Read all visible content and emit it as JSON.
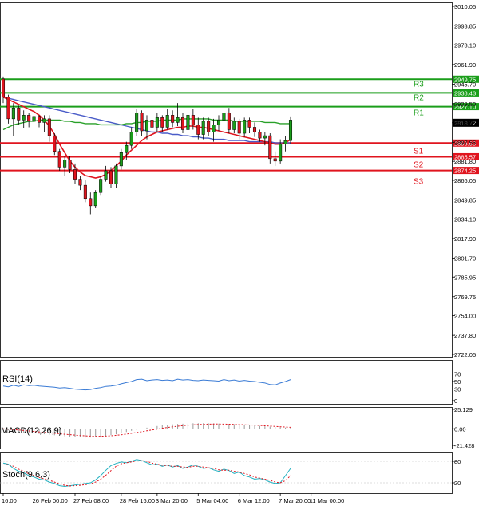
{
  "chart_data": {
    "type": "candlestick",
    "panes": {
      "price": {
        "y_ticks": [
          "3010.05",
          "2993.85",
          "2978.10",
          "2961.90",
          "2945.70",
          "2929.50",
          "2913.75",
          "2897.55",
          "2881.80",
          "2866.05",
          "2849.85",
          "2834.10",
          "2817.90",
          "2801.70",
          "2785.95",
          "2769.75",
          "2754.00",
          "2737.80",
          "2722.05"
        ],
        "ylim": [
          2722.05,
          3010.05
        ],
        "current_price": {
          "label": "2913.72",
          "value": 2913.72
        },
        "levels": [
          {
            "name": "R3",
            "value": 2949.75,
            "label": "2949.75",
            "color": "#1a9e1a"
          },
          {
            "name": "R2",
            "value": 2938.43,
            "label": "2938.43",
            "color": "#1a9e1a"
          },
          {
            "name": "R1",
            "value": 2927.1,
            "label": "2927.10",
            "color": "#1a9e1a"
          },
          {
            "name": "",
            "value": 2896.9,
            "label": "2896.90",
            "color": "#e0141e"
          },
          {
            "name": "S1",
            "value": 2885.57,
            "label": "2885.57",
            "color": "#e0141e"
          },
          {
            "name": "S2",
            "value": 2874.25,
            "label": "2874.25",
            "color": "#e0141e"
          },
          {
            "name": "S3",
            "value": 2874.25,
            "label": "",
            "color": "#e0141e"
          }
        ],
        "candles": [
          [
            2950,
            2952,
            2930,
            2935
          ],
          [
            2935,
            2937,
            2913,
            2917
          ],
          [
            2917,
            2930,
            2903,
            2926
          ],
          [
            2926,
            2928,
            2912,
            2916
          ],
          [
            2916,
            2924,
            2909,
            2920
          ],
          [
            2920,
            2922,
            2910,
            2915
          ],
          [
            2915,
            2922,
            2908,
            2919
          ],
          [
            2919,
            2920,
            2910,
            2914
          ],
          [
            2914,
            2920,
            2906,
            2917
          ],
          [
            2917,
            2920,
            2898,
            2903
          ],
          [
            2903,
            2905,
            2887,
            2890
          ],
          [
            2890,
            2892,
            2874,
            2877
          ],
          [
            2877,
            2886,
            2870,
            2883
          ],
          [
            2883,
            2886,
            2872,
            2875
          ],
          [
            2875,
            2880,
            2863,
            2867
          ],
          [
            2867,
            2870,
            2858,
            2862
          ],
          [
            2862,
            2866,
            2848,
            2851
          ],
          [
            2851,
            2856,
            2838,
            2845
          ],
          [
            2845,
            2858,
            2843,
            2856
          ],
          [
            2856,
            2870,
            2854,
            2867
          ],
          [
            2867,
            2878,
            2865,
            2874
          ],
          [
            2874,
            2877,
            2860,
            2863
          ],
          [
            2863,
            2880,
            2860,
            2878
          ],
          [
            2878,
            2892,
            2875,
            2889
          ],
          [
            2889,
            2898,
            2883,
            2895
          ],
          [
            2895,
            2910,
            2892,
            2906
          ],
          [
            2906,
            2925,
            2903,
            2922
          ],
          [
            2922,
            2924,
            2903,
            2907
          ],
          [
            2907,
            2920,
            2900,
            2916
          ],
          [
            2916,
            2918,
            2905,
            2910
          ],
          [
            2910,
            2922,
            2906,
            2918
          ],
          [
            2918,
            2920,
            2906,
            2910
          ],
          [
            2910,
            2925,
            2908,
            2920
          ],
          [
            2920,
            2924,
            2910,
            2914
          ],
          [
            2914,
            2930,
            2911,
            2918
          ],
          [
            2918,
            2922,
            2905,
            2908
          ],
          [
            2908,
            2924,
            2905,
            2920
          ],
          [
            2920,
            2925,
            2908,
            2912
          ],
          [
            2912,
            2918,
            2900,
            2904
          ],
          [
            2904,
            2918,
            2900,
            2915
          ],
          [
            2915,
            2918,
            2903,
            2906
          ],
          [
            2906,
            2917,
            2898,
            2912
          ],
          [
            2912,
            2920,
            2907,
            2916
          ],
          [
            2916,
            2930,
            2912,
            2922
          ],
          [
            2922,
            2926,
            2905,
            2908
          ],
          [
            2908,
            2918,
            2905,
            2915
          ],
          [
            2915,
            2917,
            2900,
            2905
          ],
          [
            2905,
            2918,
            2902,
            2916
          ],
          [
            2916,
            2918,
            2905,
            2910
          ],
          [
            2910,
            2914,
            2902,
            2906
          ],
          [
            2906,
            2908,
            2898,
            2901
          ],
          [
            2901,
            2906,
            2895,
            2903
          ],
          [
            2903,
            2905,
            2880,
            2884
          ],
          [
            2884,
            2890,
            2878,
            2882
          ],
          [
            2882,
            2900,
            2880,
            2896
          ],
          [
            2896,
            2903,
            2890,
            2899
          ],
          [
            2899,
            2919,
            2896,
            2916
          ]
        ],
        "ma_red": [
          2935,
          2933,
          2931,
          2929,
          2927,
          2925,
          2923,
          2920,
          2916,
          2911,
          2904,
          2896,
          2889,
          2882,
          2877,
          2873,
          2870,
          2869,
          2868,
          2869,
          2871,
          2874,
          2878,
          2882,
          2887,
          2891,
          2895,
          2899,
          2902,
          2904,
          2906,
          2907,
          2908,
          2909,
          2910,
          2910,
          2911,
          2911,
          2910,
          2910,
          2909,
          2908,
          2907,
          2906,
          2905,
          2904,
          2903,
          2902,
          2901,
          2900,
          2899,
          2898,
          2897,
          2896,
          2896,
          2897,
          2900
        ],
        "ma_green": [
          2908,
          2910,
          2912,
          2913,
          2914,
          2915,
          2915,
          2916,
          2916,
          2916,
          2916,
          2916,
          2915,
          2915,
          2914,
          2914,
          2913,
          2913,
          2913,
          2912,
          2912,
          2912,
          2912,
          2912,
          2913,
          2913,
          2914,
          2914,
          2915,
          2915,
          2915,
          2916,
          2916,
          2916,
          2916,
          2917,
          2917,
          2917,
          2917,
          2917,
          2917,
          2916,
          2916,
          2916,
          2916,
          2915,
          2915,
          2915,
          2915,
          2915,
          2915,
          2914,
          2914,
          2914,
          2913,
          2913,
          2913
        ],
        "ma_blue": [
          2935,
          2934,
          2933,
          2932,
          2931,
          2930,
          2929,
          2928,
          2927,
          2926,
          2925,
          2924,
          2923,
          2922,
          2921,
          2920,
          2919,
          2918,
          2917,
          2916,
          2915,
          2914,
          2913,
          2912,
          2911,
          2910,
          2909,
          2908,
          2907,
          2906,
          2906,
          2905,
          2905,
          2904,
          2904,
          2903,
          2903,
          2902,
          2902,
          2901,
          2901,
          2900,
          2900,
          2900,
          2899,
          2899,
          2899,
          2899,
          2898,
          2898,
          2898,
          2898,
          2898,
          2897,
          2897,
          2897,
          2897
        ]
      },
      "rsi": {
        "title": "RSI(14)",
        "y_ticks": [
          "70",
          "50",
          "30",
          "0"
        ],
        "ylim": [
          0,
          100
        ],
        "values": [
          38,
          36,
          40,
          37,
          41,
          39,
          40,
          38,
          37,
          36,
          35,
          33,
          34,
          32,
          30,
          29,
          28,
          29,
          32,
          34,
          37,
          38,
          40,
          44,
          47,
          50,
          55,
          56,
          52,
          54,
          55,
          53,
          54,
          52,
          56,
          54,
          55,
          53,
          52,
          54,
          53,
          52,
          51,
          55,
          52,
          54,
          51,
          53,
          51,
          50,
          48,
          46,
          42,
          41,
          46,
          50,
          55
        ]
      },
      "macd": {
        "title": "MACD(12,26,9)",
        "y_ticks": [
          "25.129",
          "0.00",
          "-21.428"
        ],
        "ylim": [
          -21.428,
          25.129
        ],
        "values": [
          -1,
          -2,
          -3,
          -4,
          -5,
          -5.5,
          -6,
          -6.5,
          -7,
          -7.6,
          -8.3,
          -9,
          -9.7,
          -10.3,
          -10.8,
          -11.1,
          -11.3,
          -11.2,
          -10.9,
          -10.3,
          -9.4,
          -8.3,
          -7,
          -5.6,
          -4.1,
          -2.6,
          -1.2,
          0.2,
          1.5,
          2.6,
          3.6,
          4.5,
          5.2,
          5.8,
          6.3,
          6.7,
          7,
          7.2,
          7.3,
          7.3,
          7.2,
          7,
          6.8,
          6.6,
          6.3,
          6,
          5.6,
          5.2,
          4.8,
          4.3,
          3.8,
          3.3,
          2.8,
          2.3,
          1.9,
          1.6,
          1.4
        ],
        "signal": [
          0,
          -0.5,
          -1,
          -1.6,
          -2.2,
          -2.8,
          -3.4,
          -4,
          -4.6,
          -5.2,
          -5.8,
          -6.4,
          -7,
          -7.6,
          -8.2,
          -8.7,
          -9.1,
          -9.4,
          -9.6,
          -9.6,
          -9.4,
          -9,
          -8.4,
          -7.7,
          -6.8,
          -5.8,
          -4.8,
          -3.7,
          -2.6,
          -1.5,
          -0.4,
          0.7,
          1.7,
          2.6,
          3.4,
          4.1,
          4.7,
          5.2,
          5.6,
          5.9,
          6.1,
          6.2,
          6.2,
          6.1,
          6,
          5.8,
          5.6,
          5.3,
          5,
          4.7,
          4.3,
          3.9,
          3.5,
          3.1,
          2.7,
          2.3,
          2
        ]
      },
      "stoch": {
        "title": "Stoch(9,6,3)",
        "y_ticks": [
          "80",
          "20"
        ],
        "ylim": [
          0,
          100
        ],
        "main": [
          75,
          72,
          60,
          52,
          48,
          40,
          36,
          30,
          28,
          22,
          18,
          12,
          10,
          12,
          14,
          16,
          18,
          20,
          28,
          40,
          55,
          68,
          74,
          78,
          76,
          80,
          85,
          82,
          76,
          70,
          72,
          66,
          70,
          64,
          68,
          60,
          64,
          70,
          66,
          60,
          62,
          56,
          52,
          58,
          54,
          46,
          50,
          40,
          36,
          30,
          32,
          28,
          22,
          18,
          20,
          40,
          60
        ],
        "signal": [
          70,
          71,
          66,
          58,
          52,
          45,
          40,
          35,
          31,
          27,
          22,
          17,
          13,
          11,
          12,
          13,
          15,
          17,
          22,
          30,
          41,
          54,
          66,
          73,
          76,
          78,
          81,
          82,
          80,
          75,
          72,
          69,
          68,
          66,
          66,
          64,
          63,
          66,
          66,
          64,
          62,
          60,
          56,
          55,
          55,
          52,
          50,
          46,
          42,
          36,
          33,
          30,
          27,
          22,
          20,
          26,
          40
        ]
      }
    },
    "x_labels": [
      "16:00",
      "26 Feb 00:00",
      "27 Feb 08:00",
      "28 Feb 16:00",
      "3 Mar 20:00",
      "5 Mar 04:00",
      "6 Mar 12:00",
      "7 Mar 20:00",
      "11 Mar 00:00"
    ],
    "x_label_positions": [
      0,
      6,
      14,
      23,
      30,
      38,
      46,
      54,
      60
    ],
    "colors": {
      "bull": "#1a9e1a",
      "bear": "#e0141e",
      "ma_red": "#e0141e",
      "ma_green": "#2aa12a",
      "ma_blue": "#4a5cc8",
      "rsi": "#3a7bd5",
      "macd_hist": "#999999",
      "macd_signal": "#e0141e",
      "stoch_main": "#20b0c0",
      "stoch_signal": "#e0141e",
      "current_price_box": "#000000"
    }
  }
}
